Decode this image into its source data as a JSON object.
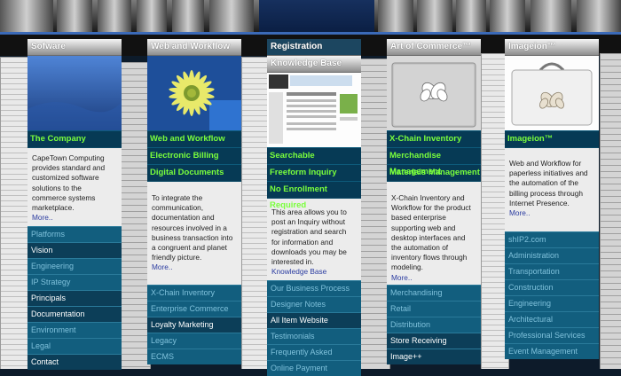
{
  "columns": [
    {
      "header": "Sofware Development",
      "nav": [
        "The Company"
      ],
      "text": "CapeTown Computing provides standard and customized software solutions to the commerce systems marketplace.",
      "more": "More..",
      "links": [
        {
          "label": "Platforms",
          "active": false
        },
        {
          "label": "Vision",
          "active": true
        },
        {
          "label": "Engineering",
          "active": false
        },
        {
          "label": "IP Strategy",
          "active": false
        },
        {
          "label": "Principals",
          "active": true
        },
        {
          "label": "Documentation",
          "active": true
        },
        {
          "label": "Environment",
          "active": false
        },
        {
          "label": "Legal",
          "active": false
        },
        {
          "label": "Contact",
          "active": true
        }
      ]
    },
    {
      "header": "Web and Workflow",
      "nav": [
        "Web and Workflow",
        "Electronic Billing",
        "Digital Documents"
      ],
      "text": "To integrate the communication, documentation and resources involved in a business transaction into a congruent and planet friendly picture.",
      "more": "More..",
      "links": [
        {
          "label": "X-Chain Inventory",
          "active": false
        },
        {
          "label": "Enterprise Commerce",
          "active": false
        },
        {
          "label": "Loyalty Marketing",
          "active": true
        },
        {
          "label": "Legacy",
          "active": false
        },
        {
          "label": "ECMS",
          "active": false
        }
      ]
    },
    {
      "header": "Registration",
      "header2": "Knowledge Base",
      "nav": [
        "Searchable",
        "Freeform Inquiry",
        "No Enrollment Required"
      ],
      "text": "This area allows you to post an Inquiry without registration and search for information and downloads you may be interested in.",
      "more": "Knowledge Base",
      "links": [
        {
          "label": "Our Business Process",
          "active": false
        },
        {
          "label": "Designer Notes",
          "active": false
        },
        {
          "label": "All Item Website",
          "active": true
        },
        {
          "label": "Testimonials",
          "active": false
        },
        {
          "label": "Frequently Asked",
          "active": false
        },
        {
          "label": "Online Payment",
          "active": false
        }
      ]
    },
    {
      "header": "Art of Commerce™",
      "nav": [
        "X-Chain Inventory",
        "Merchandise Management",
        "Materials Management"
      ],
      "text": "X-Chain Inventory and Workflow for the product based enterprise supporting web and desktop interfaces and the automation of inventory flows through modeling.",
      "more": "More..",
      "links": [
        {
          "label": "Merchandising",
          "active": false
        },
        {
          "label": "Retail",
          "active": false
        },
        {
          "label": "Distribution",
          "active": false
        },
        {
          "label": "Store Receiving",
          "active": true
        },
        {
          "label": "Image++",
          "active": true
        }
      ]
    },
    {
      "header": "Imageion™",
      "nav": [
        "Imageion™"
      ],
      "text": "Web and Workflow for paperless initiatives and the automation of the billing process through Internet Presence.",
      "more": "More..",
      "links": [
        {
          "label": "shIP2.com",
          "active": false
        },
        {
          "label": "Administration",
          "active": false
        },
        {
          "label": "Transportation",
          "active": false
        },
        {
          "label": "Construction",
          "active": false
        },
        {
          "label": "Engineering",
          "active": false
        },
        {
          "label": "Architectural",
          "active": false
        },
        {
          "label": "Professional Services",
          "active": false
        },
        {
          "label": "Event Management",
          "active": false
        }
      ]
    }
  ]
}
